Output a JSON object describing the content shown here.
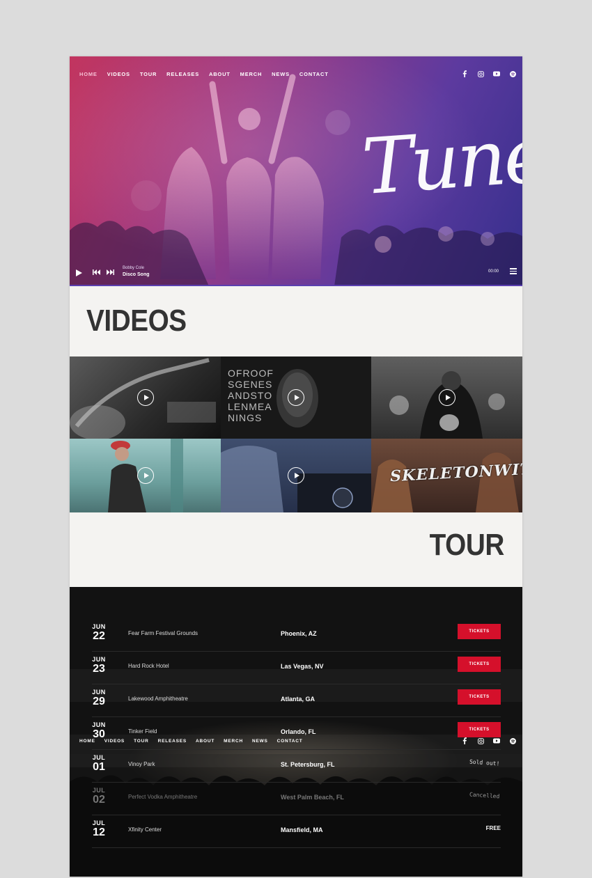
{
  "nav": {
    "items": [
      "HOME",
      "VIDEOS",
      "TOUR",
      "RELEASES",
      "ABOUT",
      "MERCH",
      "NEWS",
      "CONTACT"
    ],
    "active": "HOME"
  },
  "social": [
    "facebook-icon",
    "instagram-icon",
    "youtube-icon",
    "spotify-icon"
  ],
  "hero": {
    "brand": "Tune",
    "player": {
      "artist": "Bobby Cole",
      "title": "Disco Song",
      "time": "00:00"
    }
  },
  "videos": {
    "title": "VIDEOS",
    "tile_text": [
      "OFROOF",
      "SGENES",
      "ANDSTO",
      "LENMEA",
      "NINGS"
    ],
    "tile_logo": "SKELETONWITCH"
  },
  "tour": {
    "title": "TOUR",
    "dates": [
      {
        "month": "JUN",
        "day": "22",
        "venue": "Fear Farm Festival Grounds",
        "city": "Phoenix, AZ",
        "action": "TICKETS",
        "type": "ticket"
      },
      {
        "month": "JUN",
        "day": "23",
        "venue": "Hard Rock Hotel",
        "city": "Las Vegas, NV",
        "action": "TICKETS",
        "type": "ticket"
      },
      {
        "month": "JUN",
        "day": "29",
        "venue": "Lakewood Amphitheatre",
        "city": "Atlanta, GA",
        "action": "TICKETS",
        "type": "ticket"
      },
      {
        "month": "JUN",
        "day": "30",
        "venue": "Tinker Field",
        "city": "Orlando, FL",
        "action": "TICKETS",
        "type": "ticket"
      },
      {
        "month": "JUL",
        "day": "01",
        "venue": "Vinoy Park",
        "city": "St. Petersburg, FL",
        "action": "Sold out!",
        "type": "status"
      },
      {
        "month": "JUL",
        "day": "02",
        "venue": "Perfect Vodka Amphitheatre",
        "city": "West Palm Beach, FL",
        "action": "Cancelled",
        "type": "muted"
      },
      {
        "month": "JUL",
        "day": "12",
        "venue": "Xfinity Center",
        "city": "Mansfield, MA",
        "action": "FREE",
        "type": "free"
      }
    ]
  }
}
